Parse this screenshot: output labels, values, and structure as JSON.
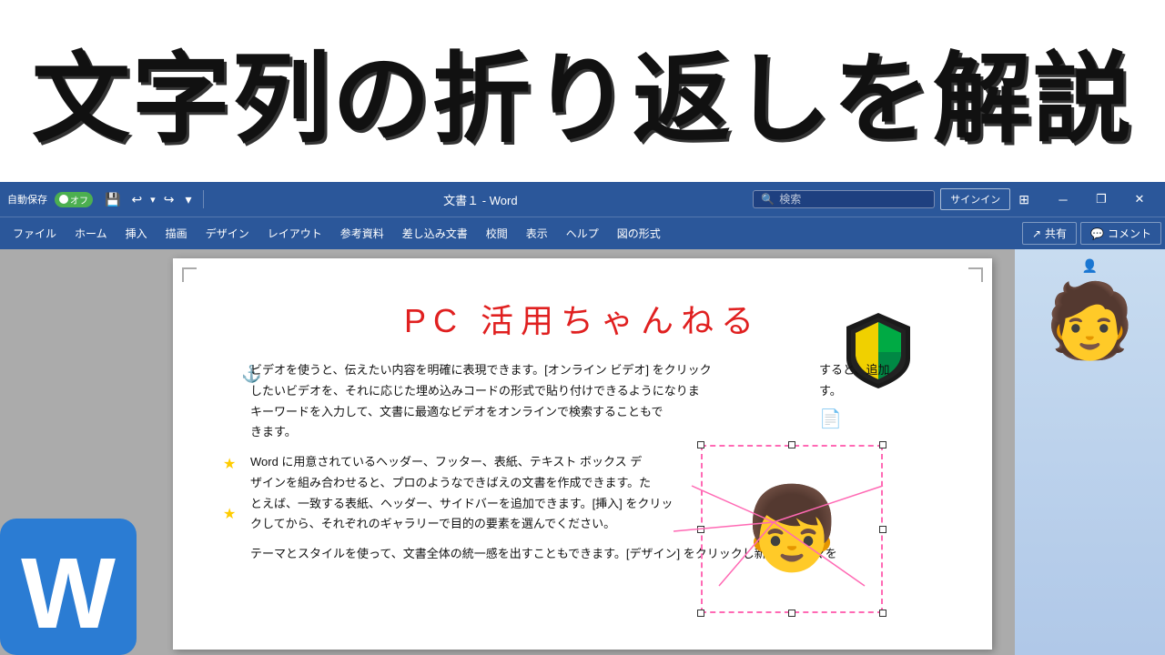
{
  "title_banner": {
    "text": "文字列の折り返しを解説"
  },
  "titlebar": {
    "autosave_label": "自動保存",
    "toggle_state": "オフ",
    "doc_name": "文書１ - Word",
    "search_placeholder": "検索",
    "signin_label": "サインイン"
  },
  "window_controls": {
    "minimize": "─",
    "restore": "❐",
    "close": "✕"
  },
  "menu": {
    "items": [
      "ファイル",
      "ホーム",
      "挿入",
      "描画",
      "デザイン",
      "レイアウト",
      "参考資料",
      "差し込み文書",
      "校閲",
      "表示",
      "ヘルプ",
      "図の形式"
    ],
    "share_label": "共有",
    "comment_label": "コメント"
  },
  "doc": {
    "channel_title": "PC 活用ちゃんねる",
    "paragraph1": "ビデオを使うと、伝えたい内容を明確に表現できます。[オンライン ビデオ] をクリック\nしたいビデオを、それに応じた埋め込みコードの形式で貼り付けできるようになりま\nキーワードを入力して、文書に最適なビデオをオンラインで検索することもで\nきます。",
    "paragraph1_end": "すると、追加\nす。",
    "paragraph2": "Word に用意されているヘッダー、フッター、表紙、テキスト ボックス デ\nザインを組み合わせると、プロのようなできばえの文書を作成できます。た\nとえば、一致する表紙、ヘッダー、サイドバーを追加できます。[挿入] をクリッ\nクしてから、それぞれのギャラリーで目的の要素を選んでください。",
    "paragraph3": "テーマとスタイルを使って、文書全体の統一感を出すこともできます。[デザイン] をクリックし新しいテーマを"
  }
}
